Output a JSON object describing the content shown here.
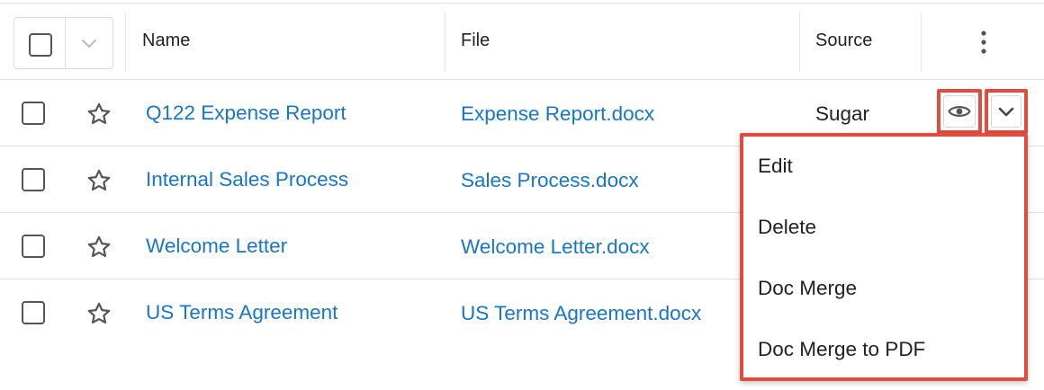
{
  "header": {
    "columns": {
      "name": "Name",
      "file": "File",
      "source": "Source"
    }
  },
  "rows": [
    {
      "name": "Q122 Expense Report",
      "file": "Expense Report.docx",
      "source": "Sugar"
    },
    {
      "name": "Internal Sales Process",
      "file": "Sales Process.docx",
      "source": ""
    },
    {
      "name": "Welcome Letter",
      "file": "Welcome Letter.docx",
      "source": ""
    },
    {
      "name": "US Terms Agreement",
      "file": "US Terms Agreement.docx",
      "source": ""
    }
  ],
  "action_menu": {
    "items": [
      "Edit",
      "Delete",
      "Doc Merge",
      "Doc Merge to PDF"
    ]
  },
  "colors": {
    "link": "#1976c5",
    "highlight": "#e24c3d",
    "border": "#e0e0e0",
    "icon": "#555555"
  },
  "icons": {
    "row_favorite": "star-icon",
    "preview": "eye-icon",
    "actions_toggle": "chevron-down-icon",
    "column_options": "kebab-icon"
  }
}
